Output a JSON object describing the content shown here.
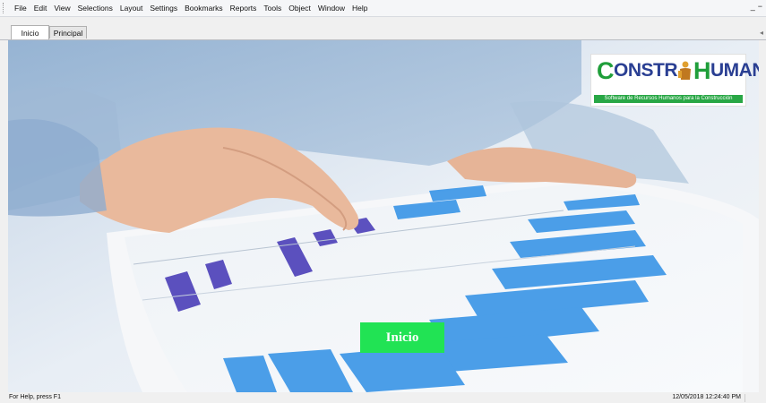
{
  "menu": {
    "items": [
      "File",
      "Edit",
      "View",
      "Selections",
      "Layout",
      "Settings",
      "Bookmarks",
      "Reports",
      "Tools",
      "Object",
      "Window",
      "Help"
    ],
    "window_controls": [
      "_",
      "−"
    ]
  },
  "tabs": [
    {
      "label": "Inicio",
      "active": true
    },
    {
      "label": "Principal",
      "active": false
    }
  ],
  "logo": {
    "part1": "C",
    "part2": "ONSTR",
    "part3": "H",
    "part4": "UMANOS",
    "tagline": "Software de Recursos Humanos para la Construcción"
  },
  "main": {
    "button_label": "Inicio"
  },
  "status": {
    "help": "For Help, press F1",
    "datetime": "12/05/2018 12:24:40 PM"
  },
  "colors": {
    "accent_button": "#21e354",
    "logo_blue": "#2a3f93",
    "logo_green": "#1f9e3a",
    "tagline_green": "#28a745"
  }
}
